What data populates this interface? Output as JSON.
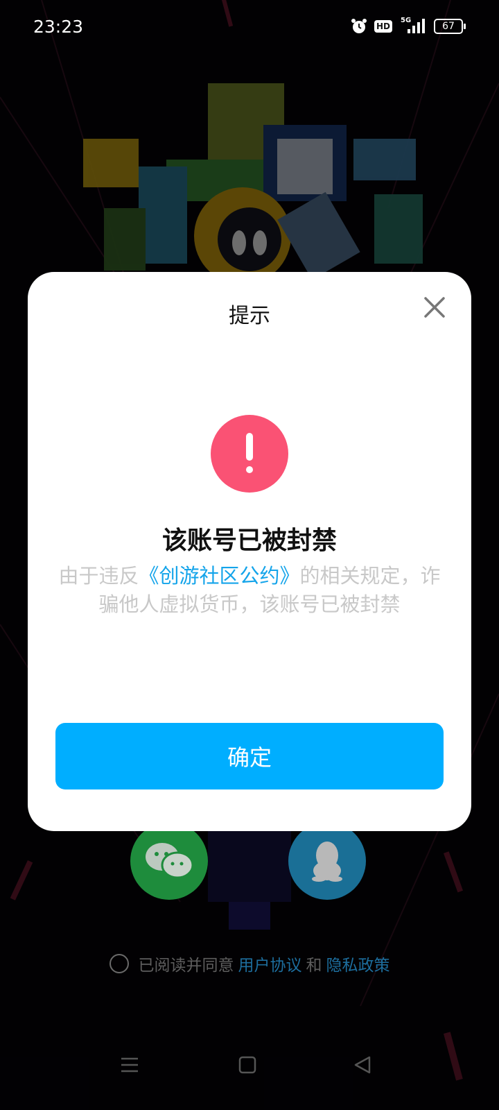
{
  "status_bar": {
    "time": "23:23",
    "hd_label": "HD",
    "network_label": "5G",
    "battery_level": "67"
  },
  "dialog": {
    "title": "提示",
    "heading": "该账号已被封禁",
    "body_prefix": "由于违反",
    "body_link": "《创游社区公约》",
    "body_suffix": "的相关规定，诈骗他人虚拟货币，该账号已被封禁",
    "confirm_label": "确定",
    "accent_color": "#00aeff",
    "warning_color": "#fa5274"
  },
  "login": {
    "wechat_icon": "wechat-icon",
    "qq_icon": "qq-icon"
  },
  "agreement": {
    "prefix": "已阅读并同意",
    "user_agreement": "用户协议",
    "and": "和",
    "privacy_policy": "隐私政策"
  },
  "nav_bar": {
    "menu_icon": "menu-icon",
    "home_icon": "home-icon",
    "back_icon": "back-icon"
  }
}
